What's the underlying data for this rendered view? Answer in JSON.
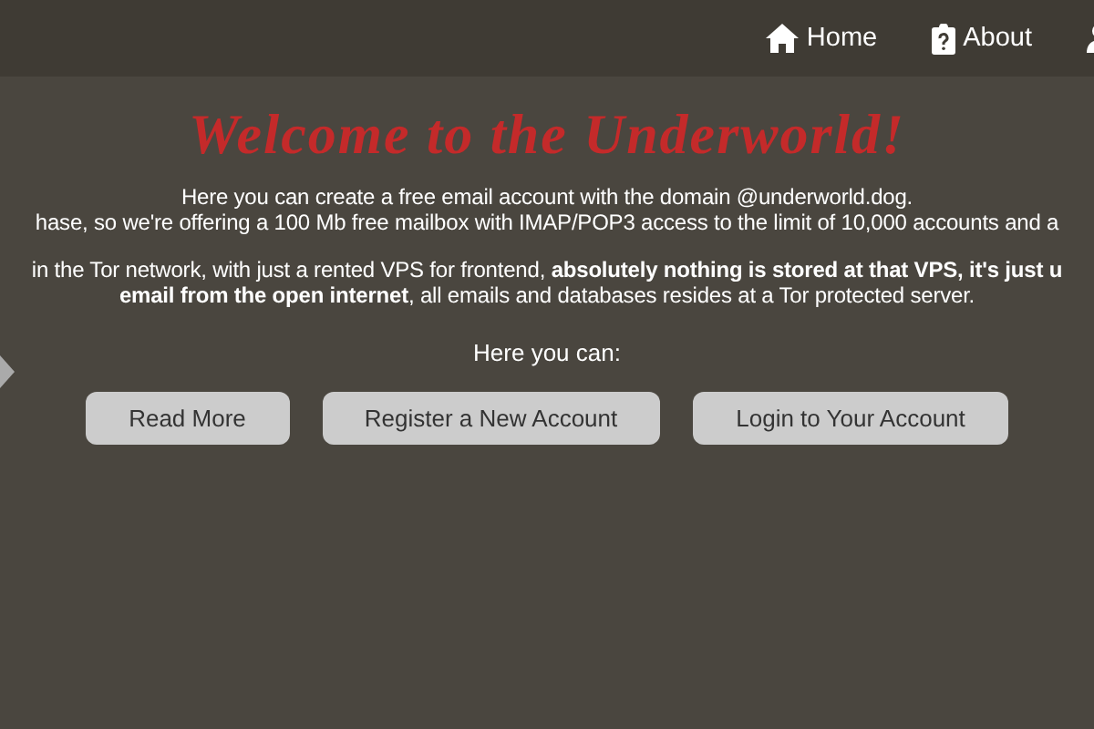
{
  "nav": [
    {
      "label": "Home"
    },
    {
      "label": "About"
    }
  ],
  "title": "Welcome to the Underworld!",
  "intro": [
    "Here you can create a free email account with the domain @underworld.dog.",
    "hase, so we're offering a 100 Mb free mailbox with IMAP/POP3 access to the limit of 10,000 accounts and a"
  ],
  "details": [
    "in the Tor network, with just a rented VPS for frontend, **absolutely nothing is stored at that VPS, it's just u**",
    "**email from the open internet**, all emails and databases resides at a Tor protected server."
  ],
  "prompt": "Here you can:",
  "buttons": [
    "Read More",
    "Register a New Account",
    "Login to Your Account"
  ]
}
